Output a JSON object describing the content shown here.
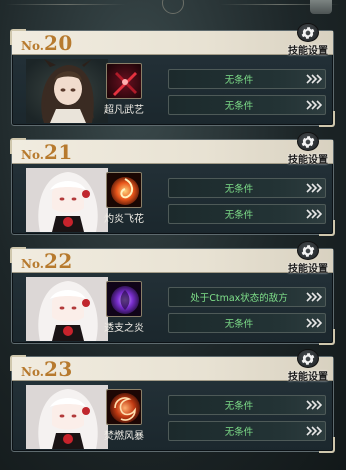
{
  "skill_set_label": "技能设置",
  "rules": [
    {
      "number_prefix": "No.",
      "number": "20",
      "skill_name": "超凡武艺",
      "skill_icon": "crossed-blades-icon",
      "character": "dark-haired-girl",
      "conditions": [
        "无条件",
        "无条件"
      ]
    },
    {
      "number_prefix": "No.",
      "number": "21",
      "skill_name": "灼炎飞花",
      "skill_icon": "fire-swirl-icon",
      "character": "white-haired-girl",
      "conditions": [
        "无条件",
        "无条件"
      ]
    },
    {
      "number_prefix": "No.",
      "number": "22",
      "skill_name": "透支之炎",
      "skill_icon": "purple-flame-icon",
      "character": "white-haired-girl",
      "conditions": [
        "处于Ctmax状态的敌方",
        "无条件"
      ]
    },
    {
      "number_prefix": "No.",
      "number": "23",
      "skill_name": "焚燃风暴",
      "skill_icon": "fire-storm-icon",
      "character": "white-haired-girl",
      "conditions": [
        "无条件",
        "无条件"
      ]
    }
  ],
  "colors": {
    "condition_text": "#7fe08a",
    "number_text": "#b77a2e",
    "header_bg": "#efeadd",
    "card_bg": "#22303a"
  }
}
